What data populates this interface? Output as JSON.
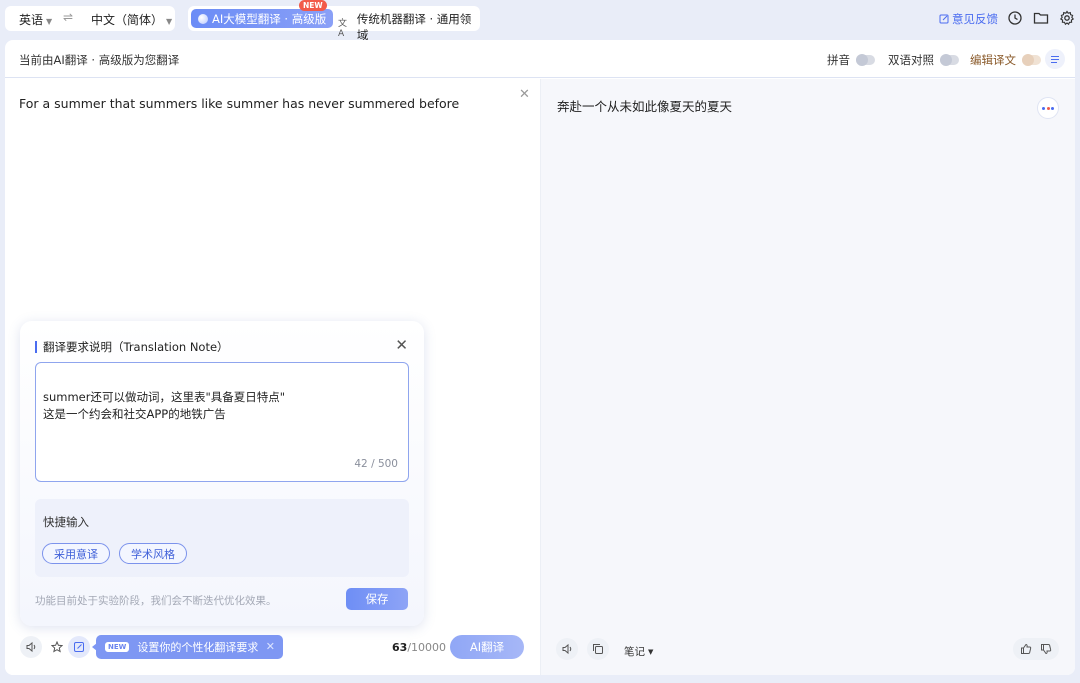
{
  "top": {
    "source_lang": "英语",
    "target_lang": "中文（简体）",
    "mode_ai_label": "AI大模型翻译 · 高级版",
    "mode_ai_badge": "NEW",
    "mode_mt_label": "传统机器翻译 · 通用领域",
    "feedback_label": "意见反馈"
  },
  "subbar": {
    "hint": "当前由AI翻译 · 高级版为您翻译",
    "pinyin_label": "拼音",
    "bilingual_label": "双语对照",
    "edit_label": "编辑译文"
  },
  "source": {
    "text": "For a summer that summers like summer has never summered before"
  },
  "target": {
    "text": "奔赴一个从未如此像夏天的夏天"
  },
  "note": {
    "title": "翻译要求说明（Translation Note）",
    "content": "summer还可以做动词，这里表\"具备夏日特点\"\n这是一个约会和社交APP的地铁广告",
    "count": "42 / 500",
    "quick_title": "快捷输入",
    "chips": [
      "采用意译",
      "学术风格"
    ],
    "footer": "功能目前处于实验阶段，我们会不断迭代优化效果。",
    "save_label": "保存"
  },
  "bottom": {
    "tip_badge": "NEW",
    "tip_text": "设置你的个性化翻译要求",
    "char_used": "63",
    "char_limit": "/10000",
    "ai_button": "AI翻译",
    "notes_label": "笔记"
  },
  "colors": {
    "accent": "#4a6cf0",
    "ai_gradient_start": "#6b8cf6",
    "badge_red": "#f25a4a",
    "edit_brown": "#8a5a2a"
  }
}
